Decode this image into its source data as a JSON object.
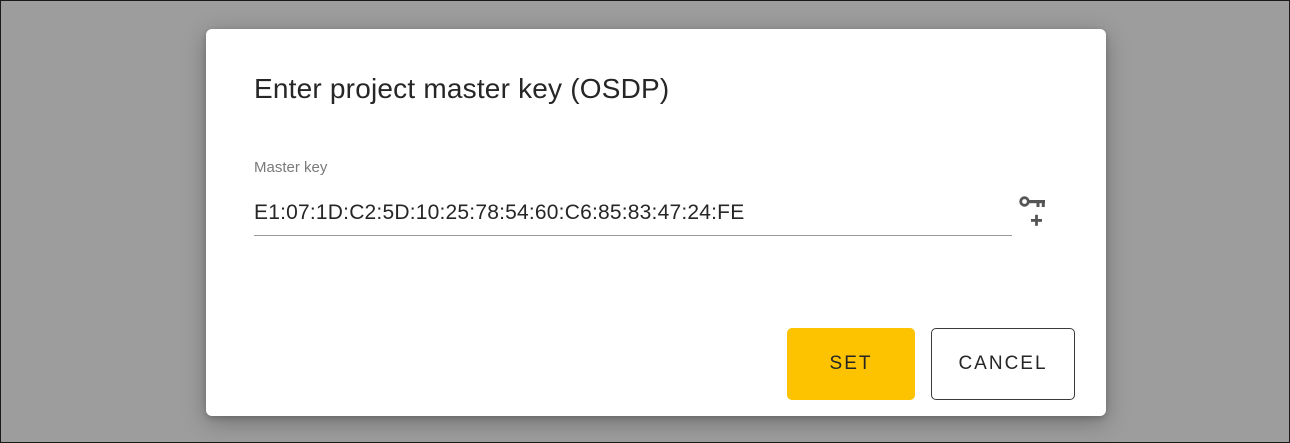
{
  "dialog": {
    "title": "Enter project master key (OSDP)",
    "master_key": {
      "label": "Master key",
      "value": "E1:07:1D:C2:5D:10:25:78:54:60:C6:85:83:47:24:FE"
    },
    "generate_key_icon": "key-plus-icon",
    "buttons": {
      "set_label": "SET",
      "cancel_label": "CANCEL"
    }
  },
  "colors": {
    "backdrop": "#9d9d9d",
    "primary_button": "#fdc300",
    "text": "#262626",
    "label": "#7a7a7a"
  }
}
